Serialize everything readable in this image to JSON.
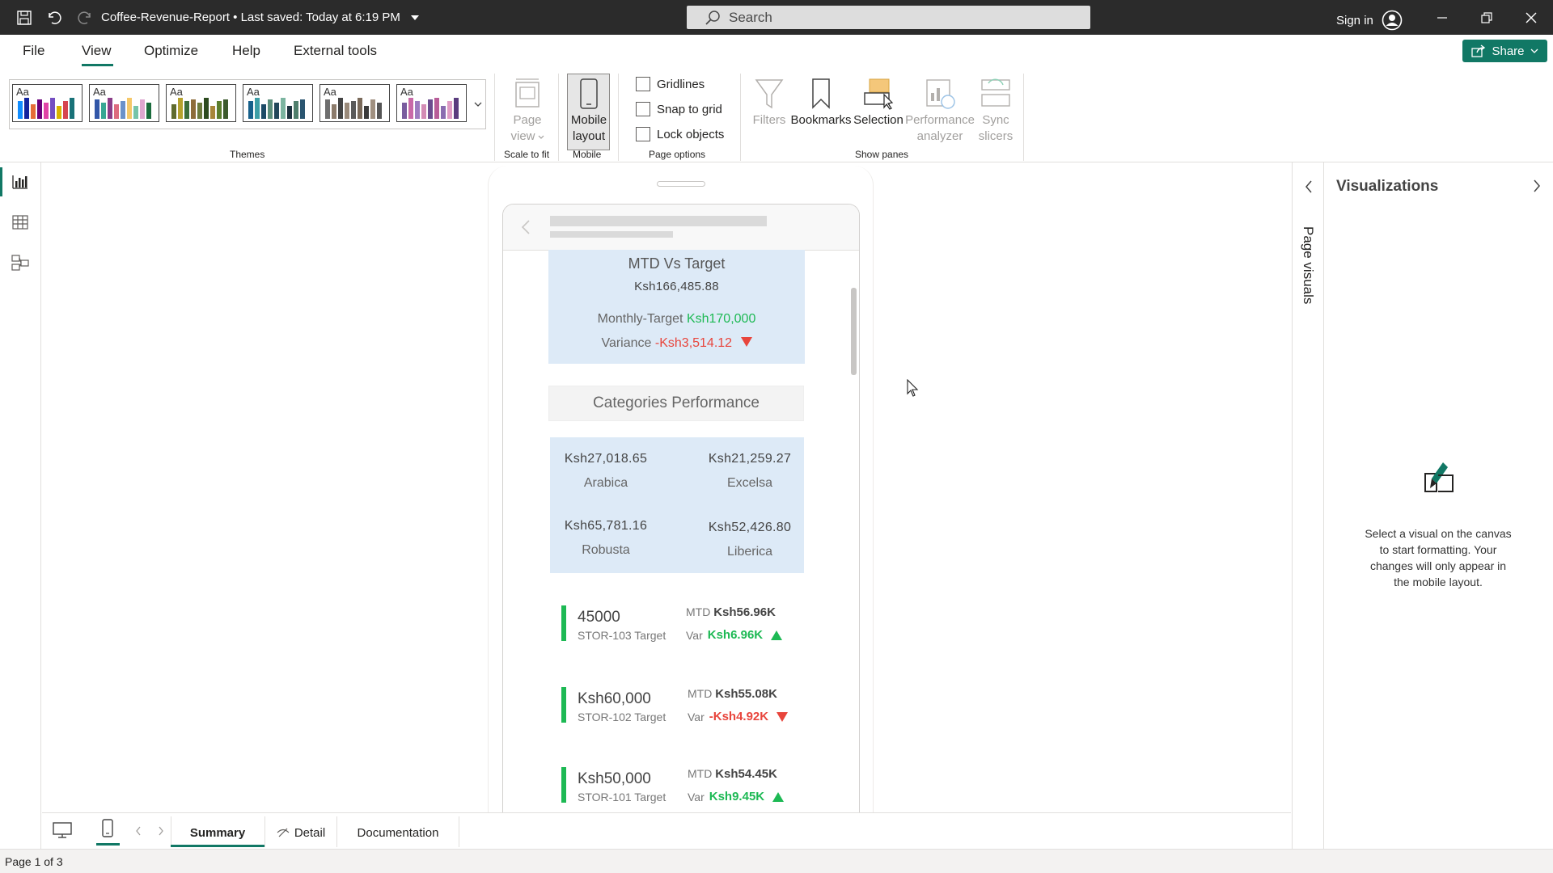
{
  "titlebar": {
    "doc_title": "Coffee-Revenue-Report • Last saved: Today at 6:19 PM",
    "search_placeholder": "Search",
    "signin_label": "Sign in"
  },
  "menu": {
    "file": "File",
    "view": "View",
    "optimize": "Optimize",
    "help": "Help",
    "external_tools": "External tools",
    "share": "Share"
  },
  "ribbon": {
    "themes_label": "Themes",
    "theme_label": "Aa",
    "page_view": [
      "Page",
      "view"
    ],
    "scale_to_fit": "Scale to fit",
    "mobile_layout": [
      "Mobile",
      "layout"
    ],
    "mobile_group": "Mobile",
    "gridlines": "Gridlines",
    "snap_to_grid": "Snap to grid",
    "lock_objects": "Lock objects",
    "page_options": "Page options",
    "filters": "Filters",
    "bookmarks": "Bookmarks",
    "selection": "Selection",
    "performance": [
      "Performance",
      "analyzer"
    ],
    "sync": [
      "Sync",
      "slicers"
    ],
    "show_panes": "Show panes"
  },
  "report": {
    "mtd_title": "MTD Vs Target",
    "mtd_value": "Ksh166,485.88",
    "monthly_target_label": "Monthly-Target",
    "monthly_target_value": "Ksh170,000",
    "variance_label": "Variance",
    "variance_value": "-Ksh3,514.12",
    "categories_title": "Categories Performance",
    "categories": [
      {
        "value": "Ksh27,018.65",
        "name": "Arabica"
      },
      {
        "value": "Ksh21,259.27",
        "name": "Excelsa"
      },
      {
        "value": "Ksh65,781.16",
        "name": "Robusta"
      },
      {
        "value": "Ksh52,426.80",
        "name": "Liberica"
      }
    ],
    "stores": [
      {
        "big": "45000",
        "sub": "STOR-103 Target",
        "mtd_label": "MTD",
        "mtd": "Ksh56.96K",
        "var_label": "Var",
        "var": "Ksh6.96K",
        "trend": "up"
      },
      {
        "big": "Ksh60,000",
        "sub": "STOR-102 Target",
        "mtd_label": "MTD",
        "mtd": "Ksh55.08K",
        "var_label": "Var",
        "var": "-Ksh4.92K",
        "trend": "down"
      },
      {
        "big": "Ksh50,000",
        "sub": "STOR-101 Target",
        "mtd_label": "MTD",
        "mtd": "Ksh54.45K",
        "var_label": "Var",
        "var": "Ksh9.45K",
        "trend": "up"
      }
    ]
  },
  "panes": {
    "page_visuals": "Page visuals",
    "visualizations": "Visualizations",
    "viz_message": "Select a visual on the canvas to start formatting. Your changes will only appear in the mobile layout."
  },
  "tabs": {
    "summary": "Summary",
    "detail": "Detail",
    "documentation": "Documentation"
  },
  "status": {
    "page_indicator": "Page 1 of 3"
  },
  "colors": {
    "accent": "#117865",
    "card_bg": "#ddeaf7",
    "positive": "#1db954",
    "negative": "#e8453c"
  }
}
